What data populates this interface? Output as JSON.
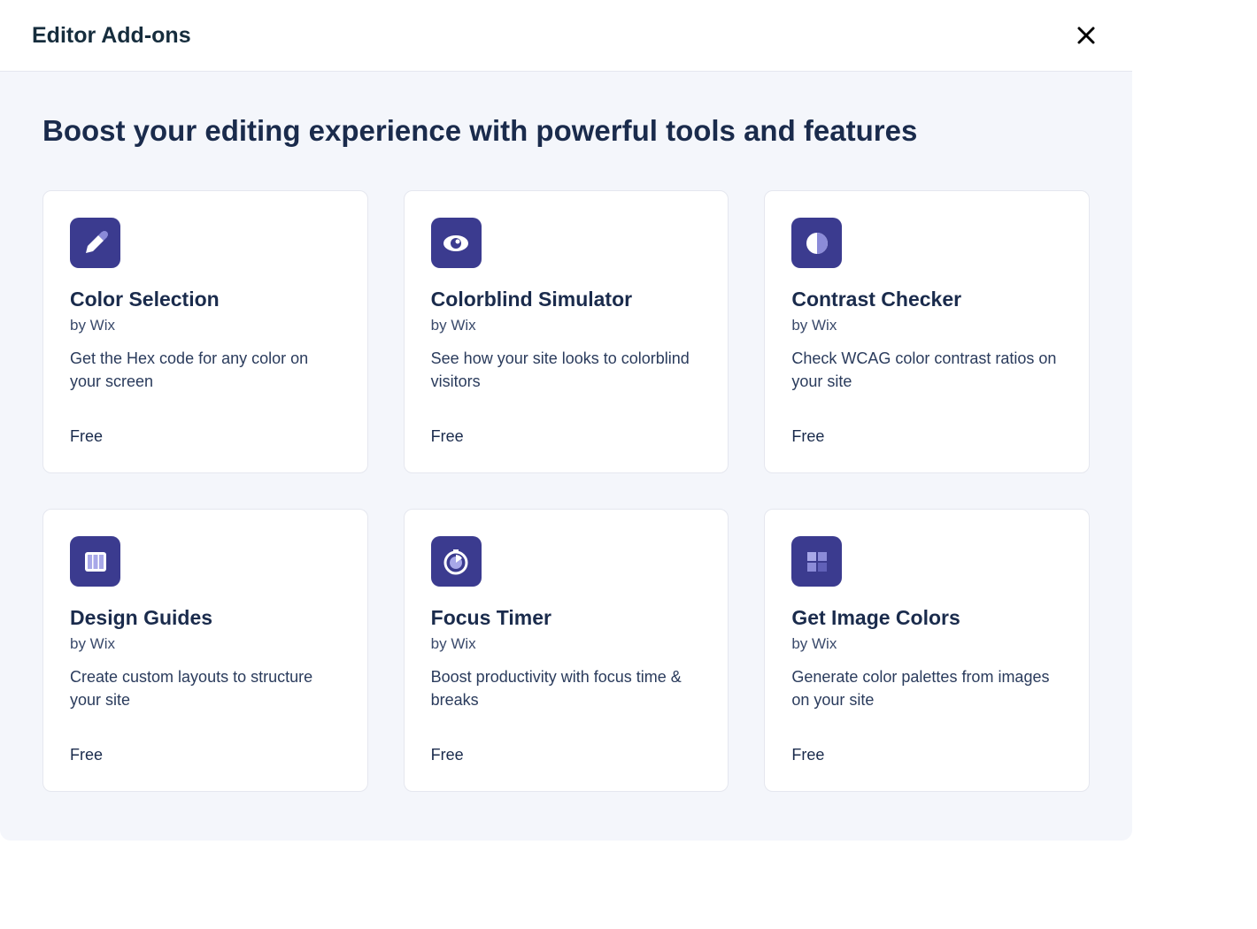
{
  "modal": {
    "title": "Editor Add-ons",
    "headline": "Boost your editing experience with powerful tools and features"
  },
  "cards": [
    {
      "title": "Color Selection",
      "author": "by Wix",
      "desc": "Get the Hex code for any color on your screen",
      "price": "Free",
      "icon": "eyedropper-icon"
    },
    {
      "title": "Colorblind Simulator",
      "author": "by Wix",
      "desc": "See how your site looks to colorblind visitors",
      "price": "Free",
      "icon": "eye-icon"
    },
    {
      "title": "Contrast Checker",
      "author": "by Wix",
      "desc": "Check WCAG color contrast ratios on your site",
      "price": "Free",
      "icon": "contrast-icon"
    },
    {
      "title": "Design Guides",
      "author": "by Wix",
      "desc": "Create custom layouts to structure your site",
      "price": "Free",
      "icon": "columns-icon"
    },
    {
      "title": "Focus Timer",
      "author": "by Wix",
      "desc": "Boost productivity with focus time & breaks",
      "price": "Free",
      "icon": "timer-icon"
    },
    {
      "title": "Get Image Colors",
      "author": "by Wix",
      "desc": "Generate color palettes from images on your site",
      "price": "Free",
      "icon": "palette-grid-icon"
    }
  ]
}
